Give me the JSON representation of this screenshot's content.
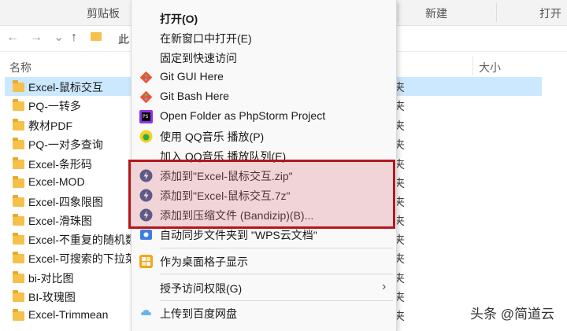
{
  "ribbon": {
    "group_clipboard": "剪贴板",
    "group_new": "新建",
    "group_open": "打开"
  },
  "nav": {
    "back": "←",
    "forward": "→",
    "recent": "⌄",
    "up": "↑",
    "address_text": "此"
  },
  "columns": {
    "name": "名称",
    "size": "大小"
  },
  "files": [
    {
      "name": "Excel-鼠标交互",
      "type": "夹"
    },
    {
      "name": "PQ-一转多",
      "type": "夹"
    },
    {
      "name": "教材PDF",
      "type": "夹"
    },
    {
      "name": "PQ-一对多查询",
      "type": "夹"
    },
    {
      "name": "Excel-条形码",
      "type": "夹"
    },
    {
      "name": "Excel-MOD",
      "type": "夹"
    },
    {
      "name": "Excel-四象限图",
      "type": "夹"
    },
    {
      "name": "Excel-滑珠图",
      "type": "夹"
    },
    {
      "name": "Excel-不重复的随机数",
      "type": "夹"
    },
    {
      "name": "Excel-可搜索的下拉菜单",
      "type": "夹"
    },
    {
      "name": "bi-对比图",
      "type": "夹"
    },
    {
      "name": "BI-玫瑰图",
      "type": "夹"
    },
    {
      "name": "Excel-Trimmean",
      "type": "夹"
    }
  ],
  "menu": {
    "open": "打开(O)",
    "open_new_window": "在新窗口中打开(E)",
    "pin_quick_access": "固定到快速访问",
    "git_gui": "Git GUI Here",
    "git_bash": "Git Bash Here",
    "phpstorm": "Open Folder as PhpStorm Project",
    "qq_play": "使用 QQ音乐 播放(P)",
    "qq_queue": "加入 QQ音乐 播放队列(E)",
    "add_zip": "添加到\"Excel-鼠标交互.zip\"",
    "add_7z": "添加到\"Excel-鼠标交互.7z\"",
    "add_archive": "添加到压缩文件 (Bandizip)(B)...",
    "wps_sync": "自动同步文件夹到 \"WPS云文档\"",
    "desktop_grid": "作为桌面格子显示",
    "grant_access": "授予访问权限(G)",
    "baidu_upload": "上传到百度网盘"
  },
  "watermark": "头条 @简道云",
  "colors": {
    "highlight_border": "#b4161c",
    "selection": "#cce8ff",
    "folder": "#f5c14a"
  }
}
